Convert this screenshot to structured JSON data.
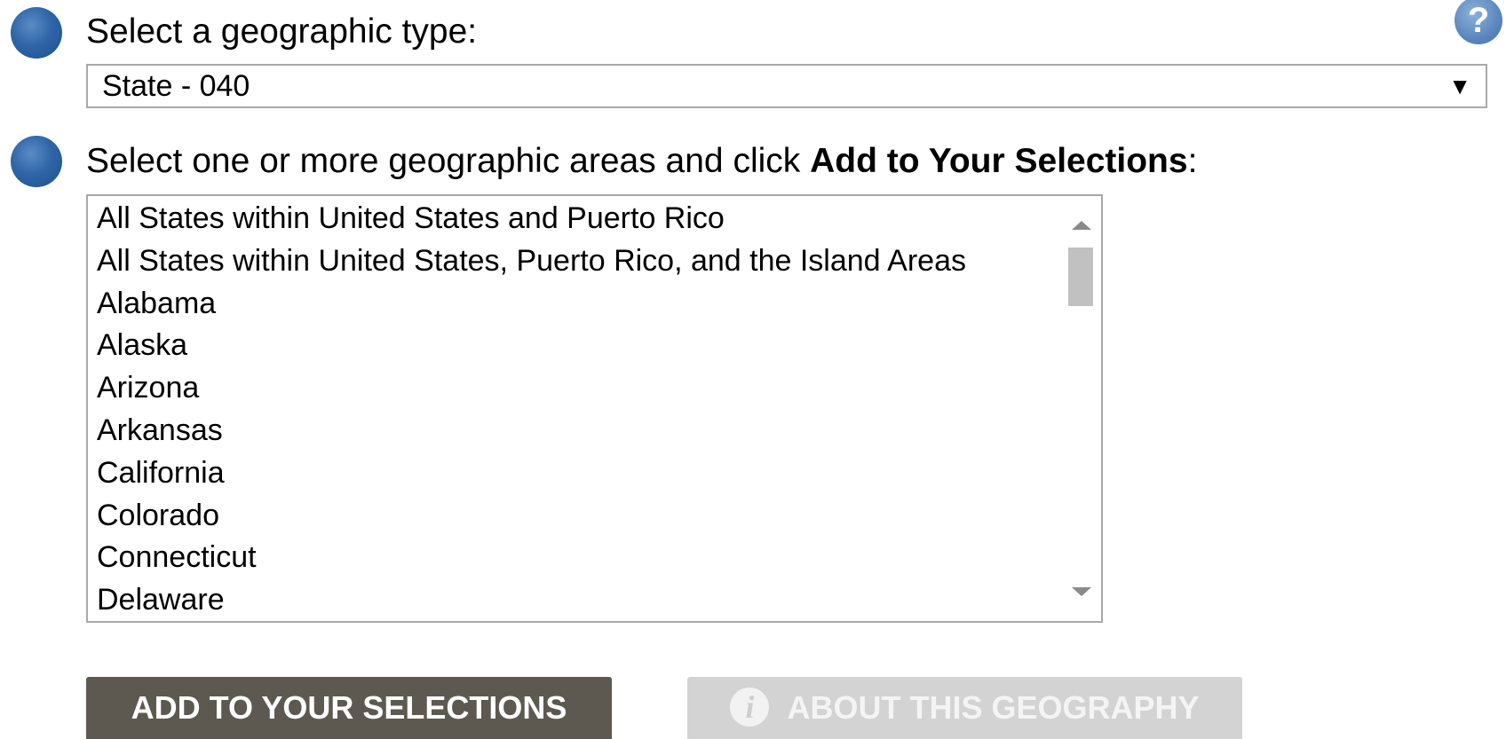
{
  "step1": {
    "label": "Select a geographic type:",
    "selected_value": "State - 040"
  },
  "step2": {
    "label_prefix": "Select one or more geographic areas and click ",
    "label_bold": "Add to Your Selections",
    "label_suffix": ":",
    "options": [
      "All States within United States and Puerto Rico",
      "All States within United States, Puerto Rico, and the Island Areas",
      "Alabama",
      "Alaska",
      "Arizona",
      "Arkansas",
      "California",
      "Colorado",
      "Connecticut",
      "Delaware"
    ]
  },
  "help": {
    "glyph": "?"
  },
  "buttons": {
    "add_label": "ADD TO YOUR SELECTIONS",
    "about_label": "ABOUT THIS GEOGRAPHY",
    "about_icon_glyph": "i"
  },
  "icons": {
    "step_bullet": "blue-circle-icon",
    "help": "help-question-icon",
    "info": "info-icon",
    "dropdown": "triangle-down-icon"
  },
  "colors": {
    "bullet_blue": "#2f66a8",
    "add_button_bg": "#5d5850",
    "about_button_bg_disabled": "#d3d3d3"
  }
}
